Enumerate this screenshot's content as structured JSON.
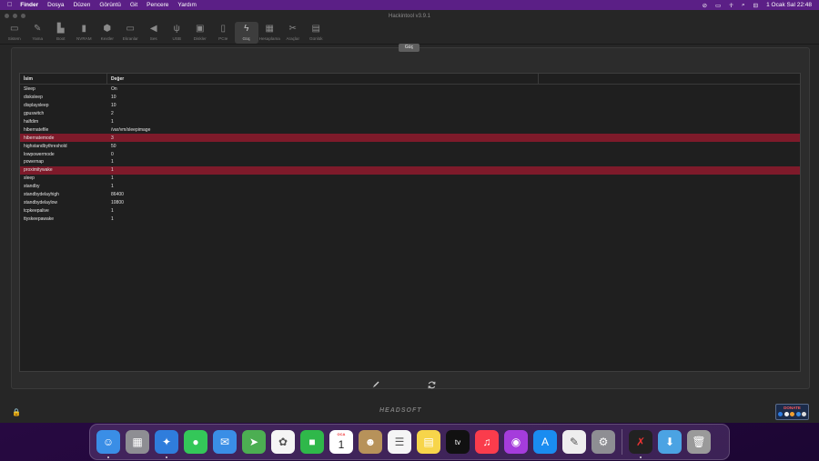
{
  "menubar": {
    "items": [
      "Finder",
      "Dosya",
      "Düzen",
      "Görüntü",
      "Git",
      "Pencere",
      "Yardım"
    ],
    "clock": "1 Ocak Sal 22:48"
  },
  "window": {
    "title": "Hackintool v3.9.1",
    "toolbar": [
      {
        "label": "Sistem",
        "icon": "system-icon"
      },
      {
        "label": "Yama",
        "icon": "patch-icon"
      },
      {
        "label": "Boot",
        "icon": "boot-icon"
      },
      {
        "label": "NVRAM",
        "icon": "nvram-icon"
      },
      {
        "label": "Kextler",
        "icon": "kexts-icon"
      },
      {
        "label": "Ekranlar",
        "icon": "displays-icon"
      },
      {
        "label": "Ses",
        "icon": "sound-icon"
      },
      {
        "label": "USB",
        "icon": "usb-icon"
      },
      {
        "label": "Diskler",
        "icon": "disks-icon"
      },
      {
        "label": "PCIe",
        "icon": "pcie-icon"
      },
      {
        "label": "Güç",
        "icon": "power-icon"
      },
      {
        "label": "Hesaplama",
        "icon": "calculator-icon"
      },
      {
        "label": "Araçlar",
        "icon": "tools-icon"
      },
      {
        "label": "Günlük",
        "icon": "log-icon"
      }
    ],
    "active_tab": "Güç",
    "group_button": "Güç",
    "table": {
      "columns": [
        "İsim",
        "Değer"
      ],
      "rows": [
        {
          "name": "Sleep",
          "value": "On"
        },
        {
          "name": "disksleep",
          "value": "10"
        },
        {
          "name": "displaysleep",
          "value": "10"
        },
        {
          "name": "gpuswitch",
          "value": "2"
        },
        {
          "name": "halfdim",
          "value": "1"
        },
        {
          "name": "hibernatefile",
          "value": "/var/vm/sleepimage"
        },
        {
          "name": "hibernatemode",
          "value": "3",
          "highlight": true
        },
        {
          "name": "highstandbythreshold",
          "value": "50"
        },
        {
          "name": "lowpowermode",
          "value": "0"
        },
        {
          "name": "powernap",
          "value": "1"
        },
        {
          "name": "proximitywake",
          "value": "1",
          "highlight": true
        },
        {
          "name": "sleep",
          "value": "1"
        },
        {
          "name": "standby",
          "value": "1"
        },
        {
          "name": "standbydelayhigh",
          "value": "86400"
        },
        {
          "name": "standbydelaylow",
          "value": "10800"
        },
        {
          "name": "tcpkeepalive",
          "value": "1"
        },
        {
          "name": "ttyskeepawake",
          "value": "1"
        }
      ]
    },
    "brand": "HEADSOFT",
    "donate": "DONATE"
  },
  "dock": {
    "calendar": {
      "month": "OCA",
      "day": "1"
    },
    "apps": [
      {
        "name": "finder",
        "color": "#3a8ee6",
        "glyph": "☺",
        "running": true
      },
      {
        "name": "launchpad",
        "color": "#8e8e93",
        "glyph": "▦"
      },
      {
        "name": "safari",
        "color": "#2f7ddc",
        "glyph": "✦",
        "running": true
      },
      {
        "name": "messages",
        "color": "#34c759",
        "glyph": "●"
      },
      {
        "name": "mail",
        "color": "#3a8ee6",
        "glyph": "✉"
      },
      {
        "name": "maps",
        "color": "#4cae52",
        "glyph": "➤"
      },
      {
        "name": "photos",
        "color": "#f5f5f5",
        "glyph": "✿"
      },
      {
        "name": "facetime",
        "color": "#2fb84a",
        "glyph": "■"
      },
      {
        "name": "calendar",
        "color": "#ffffff",
        "glyph": ""
      },
      {
        "name": "contacts",
        "color": "#b7925a",
        "glyph": "☻"
      },
      {
        "name": "reminders",
        "color": "#f5f5f5",
        "glyph": "☰"
      },
      {
        "name": "notes",
        "color": "#f7d54a",
        "glyph": "▤"
      },
      {
        "name": "apple-tv",
        "color": "#111111",
        "glyph": "tv"
      },
      {
        "name": "music",
        "color": "#fa3c4c",
        "glyph": "♫"
      },
      {
        "name": "podcasts",
        "color": "#a53cdc",
        "glyph": "◉"
      },
      {
        "name": "app-store",
        "color": "#1a8cf0",
        "glyph": "A"
      },
      {
        "name": "textedit",
        "color": "#eeeeee",
        "glyph": "✎"
      },
      {
        "name": "system-preferences",
        "color": "#8e8e93",
        "glyph": "⚙"
      },
      {
        "name": "hackintool",
        "color": "#222222",
        "glyph": "✗",
        "running": true
      },
      {
        "name": "downloads",
        "color": "#4ba3e3",
        "glyph": "⬇"
      },
      {
        "name": "trash",
        "color": "#9a9a9a",
        "glyph": "🗑"
      }
    ]
  }
}
